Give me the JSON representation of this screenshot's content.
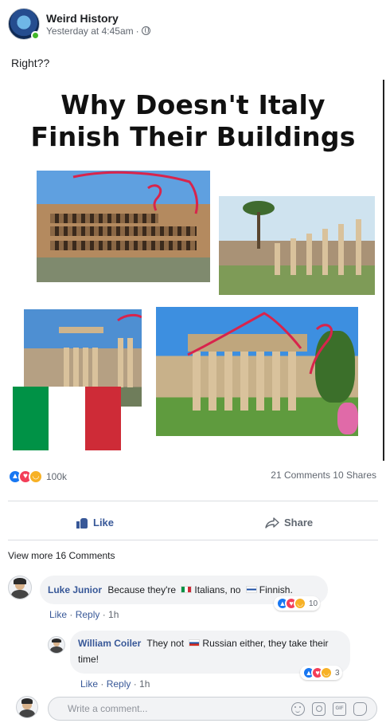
{
  "post": {
    "page_name": "Weird History",
    "timestamp": "Yesterday at 4:45am",
    "separator": "·",
    "audience_icon": "globe-icon",
    "text": "Right??"
  },
  "image": {
    "headline_line1": "Why Doesn't Italy",
    "headline_line2": "Finish Their Buildings",
    "flag_colors": [
      "#009246",
      "#ffffff",
      "#ce2b37"
    ],
    "annotation_color": "#d8244c"
  },
  "stats": {
    "reaction_count": "100k",
    "engagement": "21 Comments 10 Shares",
    "reaction_icons": [
      "like-icon",
      "love-icon",
      "haha-icon"
    ]
  },
  "actions": {
    "like_label": "Like",
    "share_label": "Share"
  },
  "comments": {
    "view_more": "View more 16 Comments",
    "items": [
      {
        "author": "Luke Junior",
        "text_before": "Because they're",
        "text_middle": "Italians, no",
        "text_after": "Finnish.",
        "reaction_count": "10",
        "like_label": "Like",
        "reply_label": "Reply",
        "time": "1h"
      },
      {
        "author": "William Coiler",
        "text_before": "They not",
        "text_after": "Russian either, they take their time!",
        "reaction_count": "3",
        "like_label": "Like",
        "reply_label": "Reply",
        "time": "1h"
      }
    ]
  },
  "composer": {
    "placeholder": "Write a comment...",
    "value": ""
  },
  "colors": {
    "link_blue": "#385898",
    "like_blue": "#1877f2",
    "love_red": "#f33e58",
    "haha_yellow": "#f7b125"
  }
}
